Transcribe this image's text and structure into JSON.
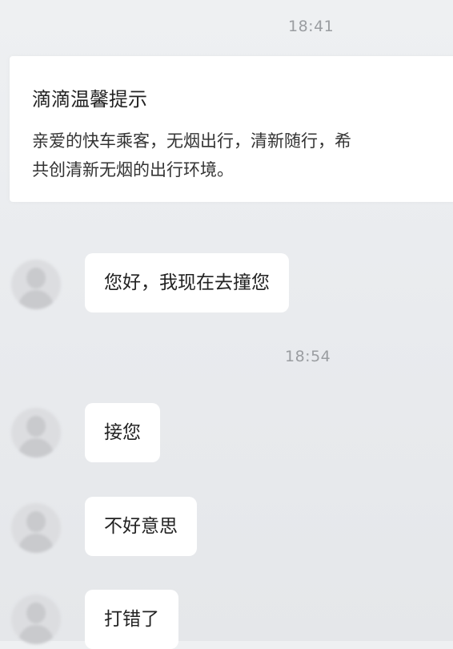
{
  "chat": {
    "timestamps": [
      "18:41",
      "18:54"
    ],
    "notice": {
      "title": "滴滴温馨提示",
      "lines": [
        "亲爱的快车乘客，无烟出行，清新随行，希",
        "共创清新无烟的出行环境。"
      ]
    },
    "messages": [
      {
        "sender": "driver",
        "text": "您好，我现在去撞您"
      },
      {
        "sender": "driver",
        "text": "接您"
      },
      {
        "sender": "driver",
        "text": "不好意思"
      },
      {
        "sender": "driver",
        "text": "打错了"
      }
    ]
  }
}
